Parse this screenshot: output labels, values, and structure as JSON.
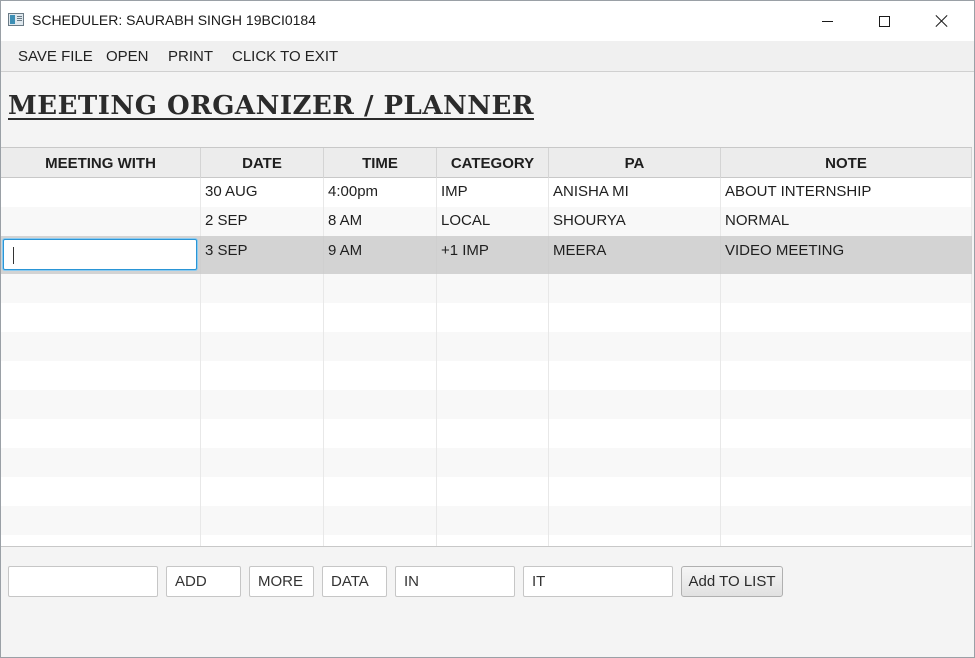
{
  "window": {
    "title": "SCHEDULER: SAURABH SINGH 19BCI0184"
  },
  "menu": [
    "SAVE FILE",
    "OPEN",
    "PRINT",
    "CLICK TO EXIT"
  ],
  "heading": "MEETING ORGANIZER / PLANNER",
  "table": {
    "columns": [
      "MEETING WITH",
      "DATE",
      "TIME",
      "CATEGORY",
      "PA",
      "NOTE"
    ],
    "rows": [
      [
        "",
        "30 AUG",
        "4:00pm",
        "IMP",
        "ANISHA MI",
        "ABOUT INTERNSHIP"
      ],
      [
        "",
        "2 SEP",
        "8 AM",
        "LOCAL",
        "SHOURYA",
        "NORMAL"
      ],
      [
        "",
        "3 SEP",
        "9 AM",
        "+1 IMP",
        "MEERA",
        "VIDEO MEETING"
      ]
    ],
    "selected_row": 3
  },
  "form": {
    "fields": [
      "",
      "ADD",
      "MORE",
      "DATA",
      "IN",
      "IT"
    ],
    "add_button": "Add TO LIST"
  },
  "colors": {
    "selection": "#d3d3d3",
    "focus_border": "#2a95d6"
  },
  "icons": [
    "app-icon",
    "minimize-icon",
    "maximize-icon",
    "close-icon"
  ]
}
